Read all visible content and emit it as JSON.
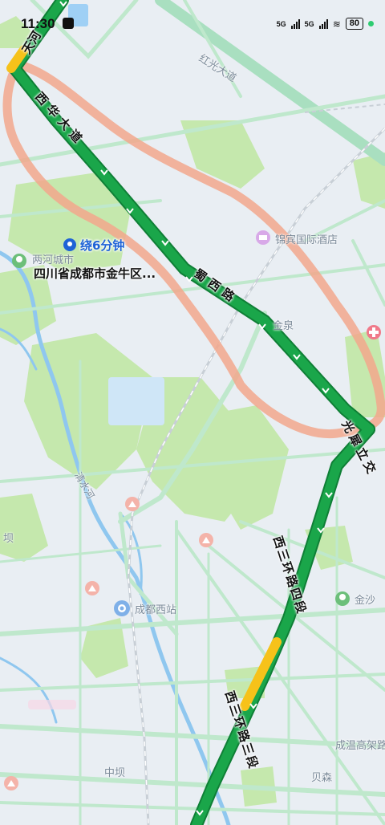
{
  "status_bar": {
    "time": "11:30",
    "network_1": "5G",
    "network_2": "5G",
    "battery": "80"
  },
  "route_card": {
    "detour_text": "绕6分钟",
    "address": "四川省成都市金牛区..."
  },
  "roads": {
    "tianhe": "天河",
    "xihua_avenue": "西华大道",
    "shuxi_road": "蜀西路",
    "guangping_interchange": "光犀立交",
    "west_third_ring_4": "西三环路四段",
    "west_third_ring_3": "西三环路三段",
    "hongguang_avenue": "红光大道",
    "chengwen_expressway": "成温高架路",
    "qingshui_river": "清水河"
  },
  "places": {
    "jinbin_hotel": "锦宾国际酒店",
    "jinquan": "金泉",
    "lianghe_park": "两河城市",
    "chengdu_west_station": "成都西站",
    "jinsha": "金沙",
    "zhongba": "中坝",
    "beisen": "贝森",
    "ba": "坝"
  },
  "colors": {
    "route_green": "#1aa64a",
    "route_yellow": "#f6c21a",
    "detour_loop": "#f0a58a",
    "park_green": "#bfe6a3",
    "road_green": "#b7e7c4",
    "water_blue": "#8fc7ef",
    "accent_blue": "#1f63d6"
  },
  "icons": [
    "location-pin-icon",
    "hotel-icon",
    "hospital-icon",
    "scenic-spot-icon",
    "train-station-icon",
    "park-icon"
  ]
}
